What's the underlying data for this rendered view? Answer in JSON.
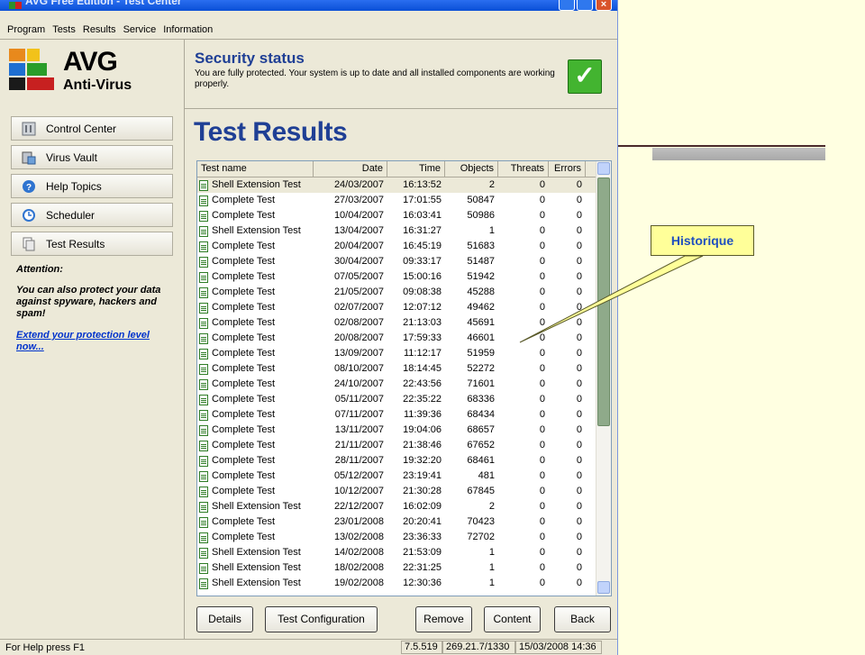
{
  "window": {
    "title": "AVG Free Edition - Test Center"
  },
  "menu": [
    "Program",
    "Tests",
    "Results",
    "Service",
    "Information"
  ],
  "logo": {
    "name": "AVG",
    "product": "Anti-Virus"
  },
  "nav": [
    {
      "label": "Control Center",
      "icon": "control-center-icon"
    },
    {
      "label": "Virus Vault",
      "icon": "virus-vault-icon"
    },
    {
      "label": "Help Topics",
      "icon": "help-icon"
    },
    {
      "label": "Scheduler",
      "icon": "scheduler-icon"
    },
    {
      "label": "Test Results",
      "icon": "test-results-icon"
    }
  ],
  "attention": {
    "heading": "Attention:",
    "text": "You can also protect your data against spyware, hackers and spam!",
    "link": "Extend your protection level now..."
  },
  "security": {
    "title": "Security status",
    "text": "You are fully protected. Your system is up to date and all installed components are working properly."
  },
  "page_title": "Test Results",
  "table": {
    "columns": [
      "Test name",
      "Date",
      "Time",
      "Objects",
      "Threats",
      "Errors"
    ],
    "rows": [
      [
        "Shell Extension Test",
        "24/03/2007",
        "16:13:52",
        "2",
        "0",
        "0"
      ],
      [
        "Complete Test",
        "27/03/2007",
        "17:01:55",
        "50847",
        "0",
        "0"
      ],
      [
        "Complete Test",
        "10/04/2007",
        "16:03:41",
        "50986",
        "0",
        "0"
      ],
      [
        "Shell Extension Test",
        "13/04/2007",
        "16:31:27",
        "1",
        "0",
        "0"
      ],
      [
        "Complete Test",
        "20/04/2007",
        "16:45:19",
        "51683",
        "0",
        "0"
      ],
      [
        "Complete Test",
        "30/04/2007",
        "09:33:17",
        "51487",
        "0",
        "0"
      ],
      [
        "Complete Test",
        "07/05/2007",
        "15:00:16",
        "51942",
        "0",
        "0"
      ],
      [
        "Complete Test",
        "21/05/2007",
        "09:08:38",
        "45288",
        "0",
        "0"
      ],
      [
        "Complete Test",
        "02/07/2007",
        "12:07:12",
        "49462",
        "0",
        "0"
      ],
      [
        "Complete Test",
        "02/08/2007",
        "21:13:03",
        "45691",
        "0",
        "0"
      ],
      [
        "Complete Test",
        "20/08/2007",
        "17:59:33",
        "46601",
        "0",
        "0"
      ],
      [
        "Complete Test",
        "13/09/2007",
        "11:12:17",
        "51959",
        "0",
        "0"
      ],
      [
        "Complete Test",
        "08/10/2007",
        "18:14:45",
        "52272",
        "0",
        "0"
      ],
      [
        "Complete Test",
        "24/10/2007",
        "22:43:56",
        "71601",
        "0",
        "0"
      ],
      [
        "Complete Test",
        "05/11/2007",
        "22:35:22",
        "68336",
        "0",
        "0"
      ],
      [
        "Complete Test",
        "07/11/2007",
        "11:39:36",
        "68434",
        "0",
        "0"
      ],
      [
        "Complete Test",
        "13/11/2007",
        "19:04:06",
        "68657",
        "0",
        "0"
      ],
      [
        "Complete Test",
        "21/11/2007",
        "21:38:46",
        "67652",
        "0",
        "0"
      ],
      [
        "Complete Test",
        "28/11/2007",
        "19:32:20",
        "68461",
        "0",
        "0"
      ],
      [
        "Complete Test",
        "05/12/2007",
        "23:19:41",
        "481",
        "0",
        "0"
      ],
      [
        "Complete Test",
        "10/12/2007",
        "21:30:28",
        "67845",
        "0",
        "0"
      ],
      [
        "Shell Extension Test",
        "22/12/2007",
        "16:02:09",
        "2",
        "0",
        "0"
      ],
      [
        "Complete Test",
        "23/01/2008",
        "20:20:41",
        "70423",
        "0",
        "0"
      ],
      [
        "Complete Test",
        "13/02/2008",
        "23:36:33",
        "72702",
        "0",
        "0"
      ],
      [
        "Shell Extension Test",
        "14/02/2008",
        "21:53:09",
        "1",
        "0",
        "0"
      ],
      [
        "Shell Extension Test",
        "18/02/2008",
        "22:31:25",
        "1",
        "0",
        "0"
      ],
      [
        "Shell Extension Test",
        "19/02/2008",
        "12:30:36",
        "1",
        "0",
        "0"
      ]
    ]
  },
  "buttons": {
    "details": "Details",
    "test_config": "Test Configuration",
    "remove": "Remove",
    "content": "Content",
    "back": "Back"
  },
  "status": {
    "help": "For Help press F1",
    "version": "7.5.519",
    "virusbase": "269.21.7/1330",
    "datetime": "15/03/2008 14:36"
  },
  "annotation": {
    "callout": "Historique"
  },
  "colors": {
    "accent": "#1f3f95",
    "status_ok": "#43b430",
    "callout_bg": "#ffff99"
  }
}
